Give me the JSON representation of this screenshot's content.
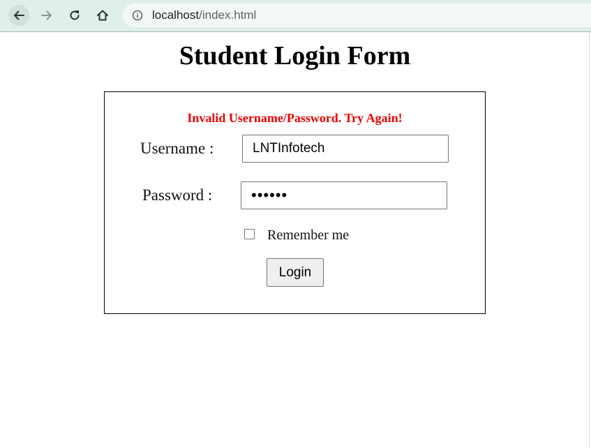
{
  "browser": {
    "url_host": "localhost",
    "url_path": "/index.html",
    "icons": {
      "back": "arrow-left-icon",
      "forward": "arrow-right-icon",
      "reload": "reload-icon",
      "home": "home-icon",
      "site_info": "info-icon"
    }
  },
  "page": {
    "title": "Student Login Form"
  },
  "form": {
    "error_message": "Invalid Username/Password. Try Again!",
    "error_color": "#ee0000",
    "username_label": "Username :",
    "username_value": "LNTInfotech",
    "password_label": "Password :",
    "password_masked": "••••••",
    "remember_label": "Remember me",
    "remember_checked": false,
    "login_button": "Login"
  }
}
